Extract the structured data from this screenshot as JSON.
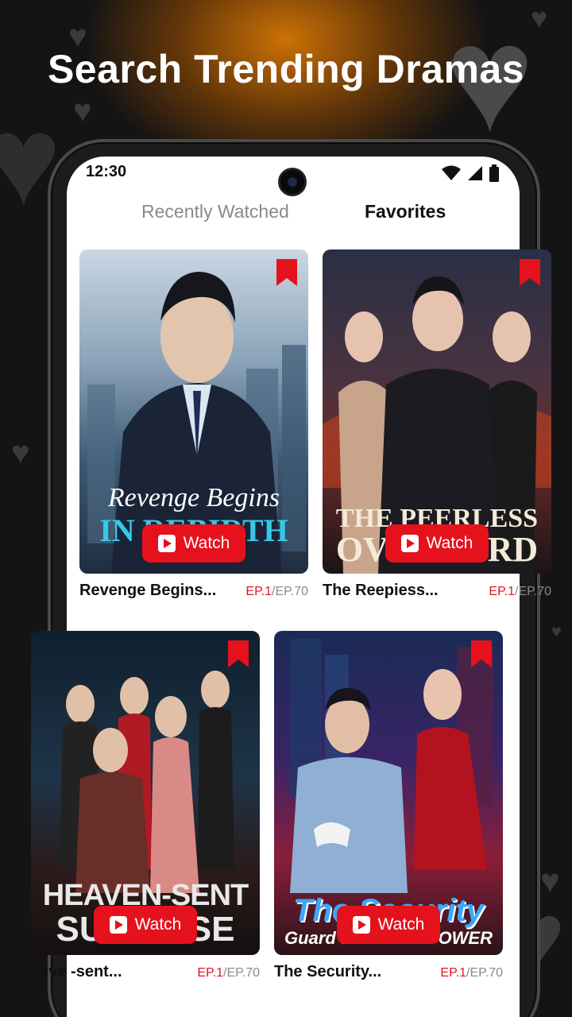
{
  "headline": "Search Trending Dramas",
  "status": {
    "time": "12:30"
  },
  "tabs": {
    "recent": "Recently Watched",
    "favorites": "Favorites"
  },
  "watch_label": "Watch",
  "cards": [
    {
      "title": "Revenge Begins...",
      "poster_line1": "Revenge Begins",
      "poster_line2": "IN REBIRTH",
      "ep_current": "EP.1",
      "ep_total": "/EP.70"
    },
    {
      "title": "The Reepiess...",
      "poster_line1": "THE PEERLESS",
      "poster_line2": "OVERLORD",
      "ep_current": "EP.1",
      "ep_total": "/EP.70"
    },
    {
      "title": "esve -sent...",
      "poster_line1": "HEAVEN-SENT",
      "poster_line2": "SURPRISE",
      "ep_current": "EP.1",
      "ep_total": "/EP.70"
    },
    {
      "title": "The Security...",
      "poster_line1": "The Security",
      "poster_line2": "Guard's HIDDEN POWER",
      "ep_current": "EP.1",
      "ep_total": "/EP.70"
    }
  ],
  "colors": {
    "accent": "#e5121d",
    "glow": "#d67606",
    "background": "#141414"
  }
}
